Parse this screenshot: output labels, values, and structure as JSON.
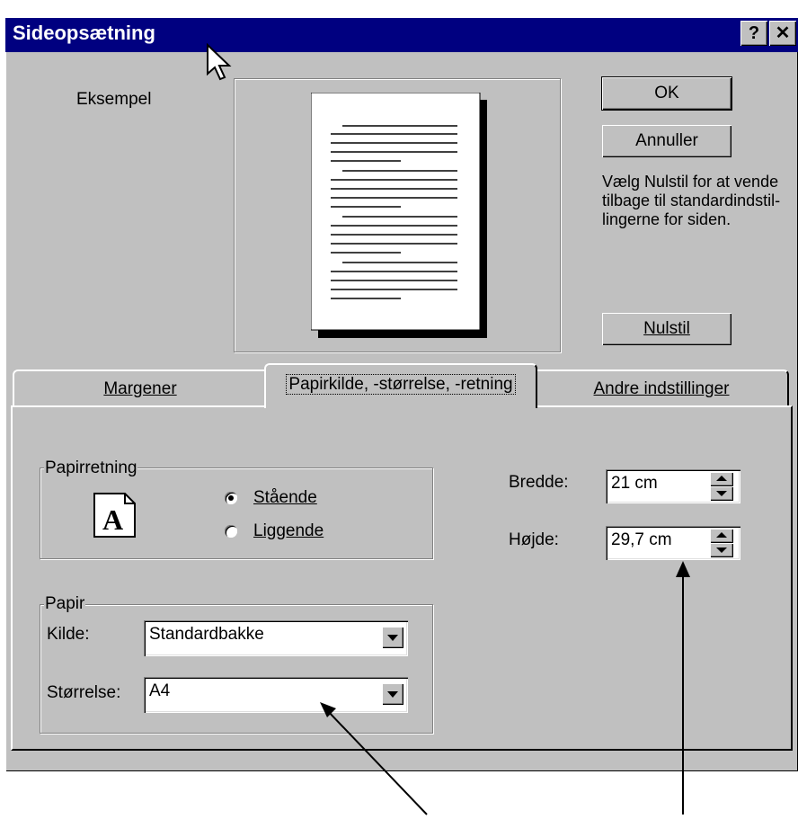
{
  "window": {
    "title": "Sideopsætning",
    "help_button": "?",
    "close_button": "✕"
  },
  "preview": {
    "label": "Eksempel"
  },
  "buttons": {
    "ok": "OK",
    "cancel": "Annuller",
    "reset": "Nulstil",
    "reset_hint": "Vælg Nulstil for at vende tilbage til standardindstil-lingerne for siden."
  },
  "tabs": [
    {
      "label": "Margener",
      "active": false
    },
    {
      "label": "Papirkilde, -størrelse, -retning",
      "active": true
    },
    {
      "label": "Andre indstillinger",
      "active": false
    }
  ],
  "orientation": {
    "group_title": "Papirretning",
    "portrait_label": "Stående",
    "landscape_label": "Liggende",
    "selected": "portrait"
  },
  "size": {
    "width_label": "Bredde:",
    "width_value": "21 cm",
    "height_label": "Højde:",
    "height_value": "29,7 cm"
  },
  "paper": {
    "group_title": "Papir",
    "source_label": "Kilde:",
    "source_value": "Standardbakke",
    "size_label": "Størrelse:",
    "size_value": "A4"
  },
  "colors": {
    "titlebar": "#000080",
    "face": "#c0c0c0"
  }
}
